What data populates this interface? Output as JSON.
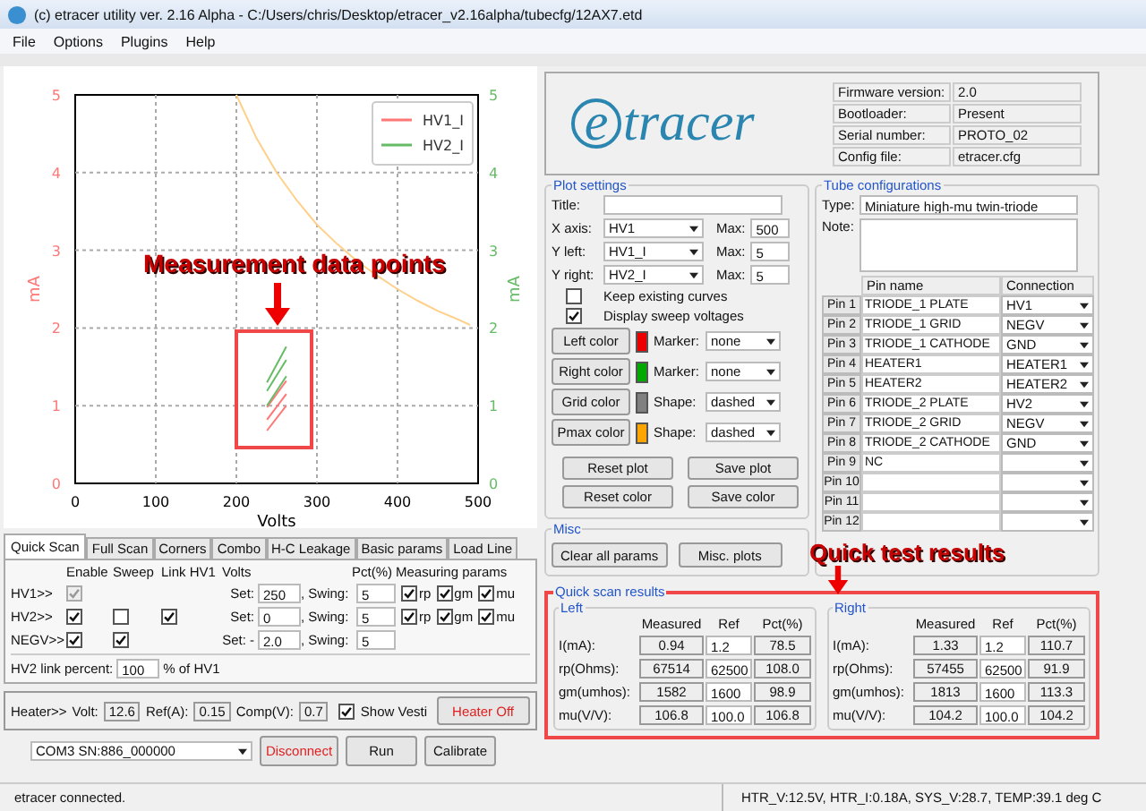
{
  "window": {
    "title": "(c) etracer utility ver. 2.16 Alpha - C:/Users/chris/Desktop/etracer_v2.16alpha/tubecfg/12AX7.etd"
  },
  "menu": [
    "File",
    "Options",
    "Plugins",
    "Help"
  ],
  "plot": {
    "chart_data": {
      "type": "line",
      "xlabel": "Volts",
      "ylabel": "mA",
      "y2label": "mA",
      "xlim": [
        0,
        500
      ],
      "ylim": [
        0,
        5
      ],
      "xticks": [
        0,
        100,
        200,
        300,
        400,
        500
      ],
      "yticks": [
        0,
        1,
        2,
        3,
        4,
        5
      ],
      "y2lim": [
        0,
        5
      ],
      "y2ticks": [
        0,
        1,
        2,
        3,
        4,
        5
      ],
      "grid": true,
      "legend": true,
      "series": [
        {
          "name": "HV1_I",
          "color": "#ff7777",
          "x": [
            238,
            262
          ],
          "values": [
            0.68,
            1.0
          ]
        },
        {
          "color": "#ff7777",
          "x": [
            238,
            262
          ],
          "values": [
            0.82,
            1.15
          ]
        },
        {
          "color": "#ff7777",
          "x": [
            238,
            262
          ],
          "values": [
            0.98,
            1.32
          ]
        },
        {
          "name": "HV2_I",
          "color": "#66bb66",
          "x": [
            238,
            262
          ],
          "values": [
            1.0,
            1.38
          ]
        },
        {
          "color": "#66bb66",
          "x": [
            238,
            262
          ],
          "values": [
            1.19,
            1.59
          ]
        },
        {
          "color": "#66bb66",
          "x": [
            238,
            262
          ],
          "values": [
            1.3,
            1.76
          ]
        },
        {
          "color": "#ffd08a",
          "x": [
            200,
            225,
            250,
            275,
            300,
            325,
            350,
            375,
            400,
            425,
            450,
            475,
            490
          ],
          "values": [
            5,
            4.44,
            4,
            3.64,
            3.33,
            3.08,
            2.86,
            2.67,
            2.5,
            2.35,
            2.22,
            2.11,
            2.04
          ]
        }
      ]
    }
  },
  "callouts": [
    {
      "text": "Measurement data points"
    },
    {
      "text": "Quick test results"
    }
  ],
  "tabs": [
    {
      "label": "Quick Scan",
      "selected": true
    },
    {
      "label": "Full Scan",
      "selected": false
    },
    {
      "label": "Corners",
      "selected": false
    },
    {
      "label": "Combo",
      "selected": false
    },
    {
      "label": "H-C Leakage",
      "selected": false
    },
    {
      "label": "Basic params",
      "selected": false
    },
    {
      "label": "Load Line",
      "selected": false
    }
  ],
  "quick_scan": {
    "headers": {
      "enable": "Enable",
      "sweep": "Sweep",
      "link": "Link HV1",
      "volts": "Volts",
      "pct": "Pct(%)",
      "params": "Measuring params"
    },
    "rows": [
      {
        "label": "HV1>>",
        "enable": {
          "checked": true,
          "disabled": true
        },
        "set_label": "Set:",
        "set": "250",
        "swing_label": ", Swing:",
        "swing": "5",
        "params": [
          {
            "label": "rp",
            "checked": true
          },
          {
            "label": "gm",
            "checked": true
          },
          {
            "label": "mu",
            "checked": true
          }
        ]
      },
      {
        "label": "HV2>>",
        "enable": {
          "checked": true,
          "disabled": false
        },
        "sweep": {
          "checked": false,
          "disabled": false
        },
        "link": {
          "checked": true,
          "disabled": false
        },
        "set_label": "Set:",
        "set": "0",
        "swing_label": ", Swing:",
        "swing": "5",
        "params": [
          {
            "label": "rp",
            "checked": true
          },
          {
            "label": "gm",
            "checked": true
          },
          {
            "label": "mu",
            "checked": true
          }
        ]
      },
      {
        "label": "NEGV>>",
        "enable": {
          "checked": true,
          "disabled": false
        },
        "sweep": {
          "checked": true,
          "disabled": false
        },
        "set_label": "Set: -",
        "set": "2.0",
        "swing_label": ", Swing:",
        "swing": "5"
      }
    ],
    "link_percent": {
      "label": "HV2 link percent:",
      "value": "100",
      "suffix": "% of HV1"
    }
  },
  "heater": {
    "label": "Heater>>",
    "volt_label": "Volt:",
    "volt": "12.6",
    "ref_label": "Ref(A):",
    "ref": "0.15",
    "comp_label": "Comp(V):",
    "comp": "0.7",
    "show": {
      "label": "Show Vesti",
      "checked": true
    },
    "button": {
      "label": "Heater Off",
      "kind": "danger"
    }
  },
  "connection": {
    "port": "COM3 SN:886_000000",
    "buttons": [
      {
        "label": "Disconnect",
        "kind": "danger"
      },
      {
        "label": "Run",
        "kind": "normal"
      },
      {
        "label": "Calibrate",
        "kind": "normal"
      }
    ]
  },
  "logo": "etracer",
  "device_info": [
    {
      "label": "Firmware version:",
      "value": "2.0"
    },
    {
      "label": "Bootloader:",
      "value": "Present"
    },
    {
      "label": "Serial number:",
      "value": "PROTO_02"
    },
    {
      "label": "Config file:",
      "value": "etracer.cfg"
    }
  ],
  "plot_settings": {
    "title": "Plot settings",
    "title_label": "Title:",
    "axes": [
      {
        "label": "X axis:",
        "value": "HV1",
        "max_label": "Max:",
        "max": "500"
      },
      {
        "label": "Y left:",
        "value": "HV1_I",
        "max_label": "Max:",
        "max": "5"
      },
      {
        "label": "Y right:",
        "value": "HV2_I",
        "max_label": "Max:",
        "max": "5"
      }
    ],
    "checks": [
      {
        "label": "Keep existing curves",
        "checked": false
      },
      {
        "label": "Display sweep voltages",
        "checked": true
      }
    ],
    "colors": [
      {
        "button": "Left color",
        "color": "#ee0000",
        "option_label": "Marker:",
        "option": "none"
      },
      {
        "button": "Right color",
        "color": "#00aa00",
        "option_label": "Marker:",
        "option": "none"
      },
      {
        "button": "Grid color",
        "color": "#808080",
        "option_label": "Shape:",
        "option": "dashed"
      },
      {
        "button": "Pmax color",
        "color": "#ffa500",
        "option_label": "Shape:",
        "option": "dashed"
      }
    ],
    "buttons": [
      "Reset plot",
      "Save plot",
      "Reset color",
      "Save color"
    ]
  },
  "misc": {
    "title": "Misc",
    "buttons": [
      "Clear all params",
      "Misc. plots"
    ]
  },
  "tube": {
    "title": "Tube configurations",
    "type_label": "Type:",
    "type": "Miniature high-mu twin-triode",
    "note_label": "Note:",
    "columns": [
      "Pin name",
      "Connection"
    ],
    "pins": [
      {
        "pin": "Pin 1",
        "name": "TRIODE_1 PLATE",
        "connection": "HV1"
      },
      {
        "pin": "Pin 2",
        "name": "TRIODE_1 GRID",
        "connection": "NEGV"
      },
      {
        "pin": "Pin 3",
        "name": "TRIODE_1 CATHODE",
        "connection": "GND"
      },
      {
        "pin": "Pin 4",
        "name": "HEATER1",
        "connection": "HEATER1"
      },
      {
        "pin": "Pin 5",
        "name": "HEATER2",
        "connection": "HEATER2"
      },
      {
        "pin": "Pin 6",
        "name": "TRIODE_2 PLATE",
        "connection": "HV2"
      },
      {
        "pin": "Pin 7",
        "name": "TRIODE_2 GRID",
        "connection": "NEGV"
      },
      {
        "pin": "Pin 8",
        "name": "TRIODE_2 CATHODE",
        "connection": "GND"
      },
      {
        "pin": "Pin 9",
        "name": "NC"
      },
      {
        "pin": "Pin 10"
      },
      {
        "pin": "Pin 11"
      },
      {
        "pin": "Pin 12"
      }
    ]
  },
  "results": {
    "title": "Quick scan results",
    "sides": [
      {
        "title": "Left",
        "columns": [
          "Measured",
          "Ref",
          "Pct(%)"
        ],
        "rows": [
          {
            "label": "I(mA):",
            "measured": "0.94",
            "ref": "1.2",
            "pct": "78.5"
          },
          {
            "label": "rp(Ohms):",
            "measured": "67514",
            "ref": "62500",
            "pct": "108.0"
          },
          {
            "label": "gm(umhos):",
            "measured": "1582",
            "ref": "1600",
            "pct": "98.9"
          },
          {
            "label": "mu(V/V):",
            "measured": "106.8",
            "ref": "100.0",
            "pct": "106.8"
          }
        ]
      },
      {
        "title": "Right",
        "columns": [
          "Measured",
          "Ref",
          "Pct(%)"
        ],
        "rows": [
          {
            "label": "I(mA):",
            "measured": "1.33",
            "ref": "1.2",
            "pct": "110.7"
          },
          {
            "label": "rp(Ohms):",
            "measured": "57455",
            "ref": "62500",
            "pct": "91.9"
          },
          {
            "label": "gm(umhos):",
            "measured": "1813",
            "ref": "1600",
            "pct": "113.3"
          },
          {
            "label": "mu(V/V):",
            "measured": "104.2",
            "ref": "100.0",
            "pct": "104.2"
          }
        ]
      }
    ]
  },
  "status_bar": {
    "message": "etracer connected.",
    "readings": "HTR_V:12.5V, HTR_I:0.18A, SYS_V:28.7, TEMP:39.1 deg C"
  }
}
